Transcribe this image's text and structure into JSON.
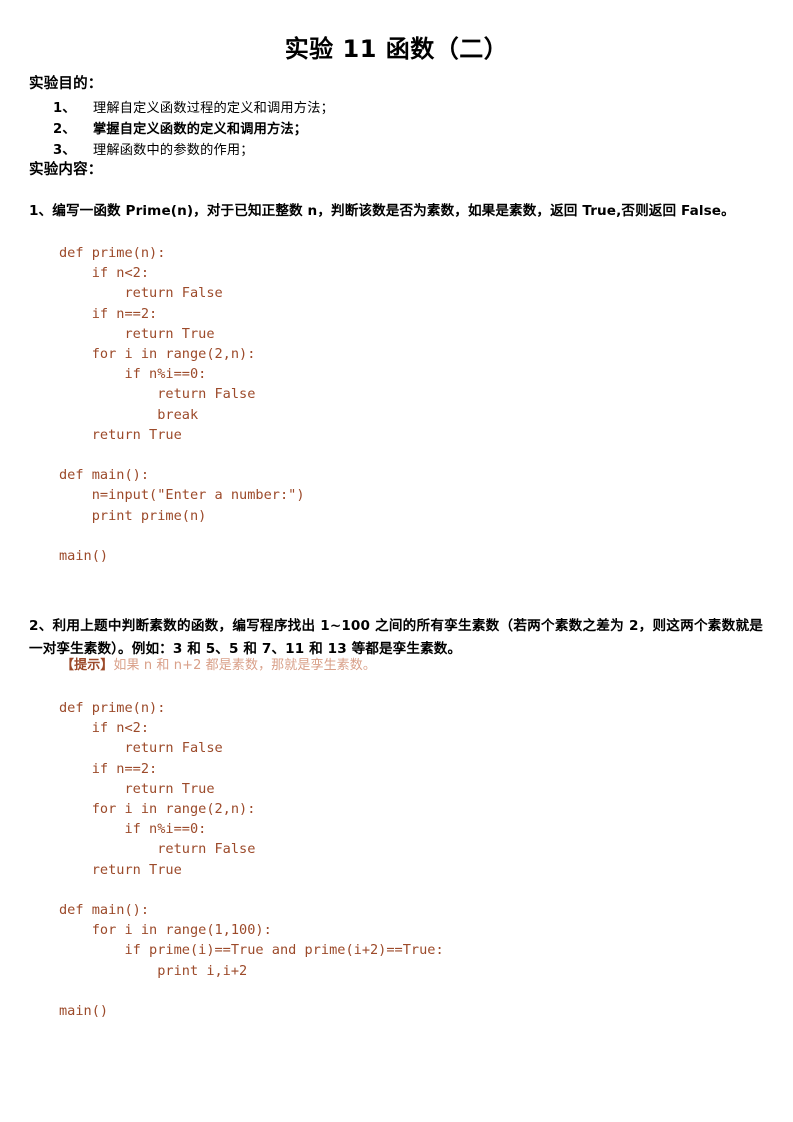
{
  "document": {
    "title": "实验 11  函数（二）",
    "sections": {
      "purpose_heading": "实验目的：",
      "content_heading": "实验内容："
    },
    "objectives": [
      {
        "num": "1、",
        "text": "理解自定义函数过程的定义和调用方法；",
        "bold": false
      },
      {
        "num": "2、",
        "text": "掌握自定义函数的定义和调用方法；",
        "bold": true
      },
      {
        "num": "3、",
        "text": "理解函数中的参数的作用；",
        "bold": false
      }
    ],
    "questions": [
      {
        "id": "q1",
        "text": "1、编写一函数 Prime(n)，对于已知正整数 n，判断该数是否为素数，如果是素数，返回 True,否则返回 False。"
      },
      {
        "id": "q2",
        "text": "2、利用上题中判断素数的函数，编写程序找出 1~100 之间的所有孪生素数（若两个素数之差为 2，则这两个素数就是一对孪生素数）。例如：3 和 5、5 和 7、11 和 13 等都是孪生素数。"
      }
    ],
    "hint": {
      "label": "【提示】",
      "text": "如果 n 和 n+2 都是素数，那就是孪生素数。"
    },
    "code_blocks": [
      {
        "id": "code1",
        "lines": [
          "def prime(n):",
          "    if n<2:",
          "        return False",
          "    if n==2:",
          "        return True",
          "    for i in range(2,n):",
          "        if n%i==0:",
          "            return False",
          "            break",
          "    return True",
          "",
          "def main():",
          "    n=input(\"Enter a number:\")",
          "    print prime(n)",
          "",
          "main()"
        ]
      },
      {
        "id": "code2",
        "lines": [
          "def prime(n):",
          "    if n<2:",
          "        return False",
          "    if n==2:",
          "        return True",
          "    for i in range(2,n):",
          "        if n%i==0:",
          "            return False",
          "    return True",
          "",
          "def main():",
          "    for i in range(1,100):",
          "        if prime(i)==True and prime(i+2)==True:",
          "            print i,i+2",
          "",
          "main()"
        ]
      }
    ],
    "colors": {
      "code_text": "#9c4a2a",
      "hint_label": "#9c4a2a",
      "hint_text": "#d9a089",
      "body_text": "#000000",
      "page_background": "#ffffff"
    }
  }
}
